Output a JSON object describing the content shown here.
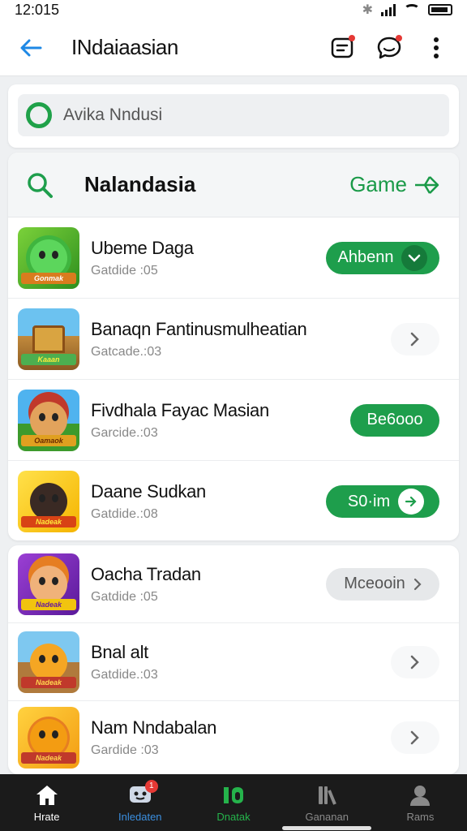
{
  "status_bar": {
    "time": "12:015"
  },
  "app_bar": {
    "title": "INdaiaasian"
  },
  "search": {
    "placeholder": "Avika Nndusi"
  },
  "section": {
    "title": "Nalandasia",
    "link_label": "Game"
  },
  "list_top": [
    {
      "title": "Ubeme Daga",
      "subtitle": "Gatdide :05",
      "action": {
        "type": "pill",
        "label": "Ahbenn",
        "style": "green",
        "chevron": "down"
      }
    },
    {
      "title": "Banaqn Fantinusmulheatian",
      "subtitle": "Gatcade.:03",
      "action": {
        "type": "chevron"
      }
    },
    {
      "title": "Fivdhala Fayac Masian",
      "subtitle": "Garcide.:03",
      "action": {
        "type": "pill",
        "label": "Be6ooo",
        "style": "green"
      }
    },
    {
      "title": "Daane Sudkan",
      "subtitle": "Gatdide.:08",
      "action": {
        "type": "pill",
        "label": "S0·im",
        "style": "green",
        "chevron": "right"
      }
    }
  ],
  "list_bottom": [
    {
      "title": "Oacha Tradan",
      "subtitle": "Gatdide :05",
      "action": {
        "type": "pill",
        "label": "Mceooin",
        "style": "grey",
        "chevron": "right"
      }
    },
    {
      "title": "Bnal alt",
      "subtitle": "Gatdide.:03",
      "action": {
        "type": "chevron"
      }
    },
    {
      "title": "Nam Nndabalan",
      "subtitle": "Gardide :03",
      "action": {
        "type": "chevron"
      }
    }
  ],
  "bottom_nav": [
    {
      "label": "Hrate",
      "icon": "home-icon",
      "color": "#ffffff",
      "badge": ""
    },
    {
      "label": "Inledaten",
      "icon": "chat-icon",
      "color": "#3b8fe0",
      "badge": "1"
    },
    {
      "label": "Dnatak",
      "icon": "games-icon",
      "color": "#25b34b",
      "badge": ""
    },
    {
      "label": "Gananan",
      "icon": "bars-icon",
      "color": "#8a8a8a",
      "badge": ""
    },
    {
      "label": "Rams",
      "icon": "profile-icon",
      "color": "#8a8a8a",
      "badge": ""
    }
  ],
  "colors": {
    "accent": "#1e9e4c",
    "nav_bg": "#1b1b1b",
    "back_arrow": "#1e88e5"
  }
}
